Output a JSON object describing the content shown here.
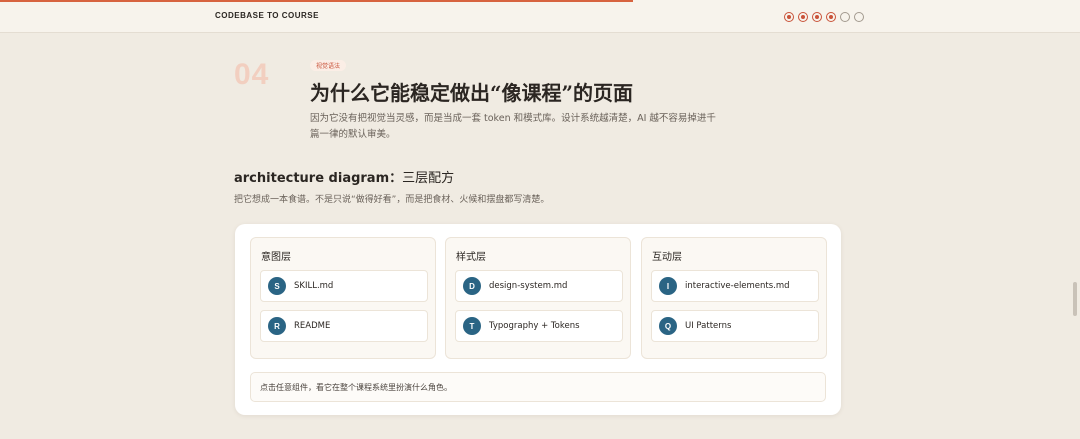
{
  "header": {
    "brand": "CODEBASE TO COURSE",
    "progress_fraction": 0.586,
    "nav_dots": [
      {
        "label": "1",
        "active": true
      },
      {
        "label": "2",
        "active": true
      },
      {
        "label": "3",
        "active": true
      },
      {
        "label": "4",
        "active": true
      },
      {
        "label": "5",
        "active": false
      },
      {
        "label": "6",
        "active": false
      }
    ]
  },
  "section": {
    "number": "04",
    "tag": "视觉语法",
    "title": "为什么它能稳定做出“像课程”的页面",
    "description": "因为它没有把视觉当灵感，而是当成一套 token 和模式库。设计系统越清楚，AI 越不容易掉进千篇一律的默认审美。"
  },
  "diagram": {
    "title_en": "architecture diagram：",
    "title_cn": "三层配方",
    "subtitle": "把它想成一本食谱。不是只说“做得好看”，而是把食材、火候和摆盘都写清楚。",
    "layers": [
      {
        "title": "意图层",
        "items": [
          {
            "badge": "S",
            "label": "SKILL.md"
          },
          {
            "badge": "R",
            "label": "README"
          }
        ]
      },
      {
        "title": "样式层",
        "items": [
          {
            "badge": "D",
            "label": "design-system.md"
          },
          {
            "badge": "T",
            "label": "Typography + Tokens"
          }
        ]
      },
      {
        "title": "互动层",
        "items": [
          {
            "badge": "I",
            "label": "interactive-elements.md"
          },
          {
            "badge": "Q",
            "label": "UI Patterns"
          }
        ]
      }
    ],
    "hint": "点击任意组件，看它在整个课程系统里扮演什么角色。"
  },
  "colors": {
    "accent": "#d7633f",
    "badge": "#2a6484",
    "background": "#f0ebe2"
  }
}
